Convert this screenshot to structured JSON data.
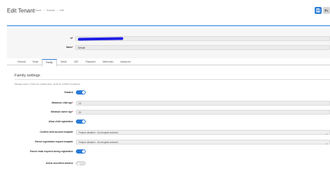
{
  "page": {
    "title": "Edit Tenant",
    "breadcrumb": [
      "Home",
      "Tenants",
      "Edit"
    ]
  },
  "toolbar": {
    "save_icon": "save-icon",
    "back_icon": "back-arrow-icon",
    "save_color": "#2b7bd6"
  },
  "identity": {
    "id_label": "Id",
    "id_value": "",
    "name_label": "Name",
    "name_value": "Default"
  },
  "tabs": [
    "General",
    "Email",
    "Family",
    "OAuth",
    "JWT",
    "Password",
    "Webhooks",
    "Advanced"
  ],
  "active_tab": "Family",
  "family": {
    "title": "Family settings",
    "description": "Manage parent / child user relationships, useful for COPPA compliance.",
    "enabled_label": "Enabled",
    "enabled": true,
    "max_child_age_label": "Maximum child age",
    "max_child_age": "12",
    "min_owner_age_label": "Minimum owner age",
    "min_owner_age": "21",
    "allow_child_reg_label": "Allow child registration",
    "allow_child_reg": true,
    "confirm_child_tpl_label": "Confirm child account template",
    "confirm_child_tpl": "Feature disabled - No template selected",
    "parent_reg_tpl_label": "Parent registration request template",
    "parent_reg_tpl": "Feature disabled - No template selected",
    "parent_email_required_label": "Parent email required during registration",
    "parent_email_required": true,
    "delete_orphaned_label": "Delete unverified children",
    "delete_orphaned": false
  }
}
